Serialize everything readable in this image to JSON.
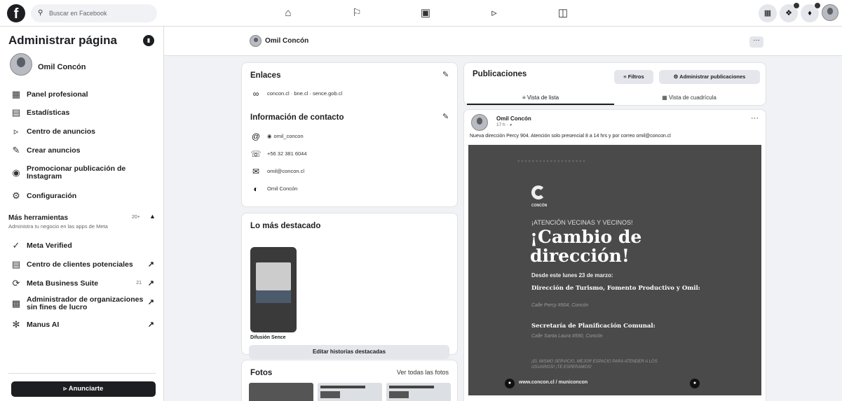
{
  "topbar": {
    "logo": "f",
    "search_placeholder": "Buscar en Facebook",
    "nav_icons": [
      "home-icon",
      "flag-icon",
      "video-icon",
      "megaphone-icon",
      "calendar-icon"
    ],
    "right_icons": [
      "grid-icon",
      "messenger-icon",
      "bell-icon",
      "profile-icon"
    ]
  },
  "sidebar": {
    "title": "Administrar página",
    "page_name": "Omil Concón",
    "items": [
      {
        "label": "Panel profesional",
        "icon": "dashboard-icon"
      },
      {
        "label": "Estadísticas",
        "icon": "chart-icon"
      },
      {
        "label": "Centro de anuncios",
        "icon": "megaphone-icon"
      },
      {
        "label": "Crear anuncios",
        "icon": "pencil-icon"
      },
      {
        "label": "Promocionar publicación de Instagram",
        "icon": "instagram-icon"
      },
      {
        "label": "Configuración",
        "icon": "gear-icon"
      }
    ],
    "more_tools": {
      "title": "Más herramientas",
      "subtitle": "Administra tu negocio en las apps de Meta",
      "count": "20+"
    },
    "tools": [
      {
        "label": "Meta Verified",
        "icon": "verified-icon",
        "count": "",
        "external": false
      },
      {
        "label": "Centro de clientes potenciales",
        "icon": "leads-icon",
        "count": "",
        "external": true
      },
      {
        "label": "Meta Business Suite",
        "icon": "business-suite-icon",
        "count": "21",
        "external": true
      },
      {
        "label": "Administrador de organizaciones sin fines de lucro",
        "icon": "nonprofit-icon",
        "count": "",
        "external": true
      },
      {
        "label": "Manus AI",
        "icon": "manus-icon",
        "count": "",
        "external": true
      }
    ],
    "promote_button": "Anunciarte"
  },
  "pagebar": {
    "name": "Omil Concón",
    "more": "···"
  },
  "links_card": {
    "title": "Enlaces",
    "links": "concon.cl · bne.cl · sence.gob.cl"
  },
  "contact_card": {
    "title": "Información de contacto",
    "rows": [
      {
        "icon": "at-icon",
        "text": "omil_concon"
      },
      {
        "icon": "phone-icon",
        "text": "+56 32 381 6044"
      },
      {
        "icon": "mail-icon",
        "text": "omil@concon.cl"
      },
      {
        "icon": "messenger-icon",
        "text": "Omil Concón"
      }
    ]
  },
  "highlights_card": {
    "title": "Lo más destacado",
    "story_label": "Difusión Sence",
    "edit_button": "Editar historias destacadas"
  },
  "photos_card": {
    "title": "Fotos",
    "see_all": "Ver todas las fotos"
  },
  "posts": {
    "title": "Publicaciones",
    "filters_button": "Filtros",
    "manage_button": "Administrar publicaciones",
    "tab_list": "Vista de lista",
    "tab_grid": "Vista de cuadrícula"
  },
  "post": {
    "author": "Omil Concón",
    "time": "17 h · ",
    "text": "Nueva dirección Percy 904. Atención solo presencial 8 a 14 hrs y por correo omil@concon.cl",
    "image": {
      "logo_text": "CONCÓN",
      "attention": "¡ATENCIÓN VECINAS Y VECINOS!",
      "headline_1": "¡Cambio de",
      "headline_2": "dirección!",
      "since": "Desde este lunes 23 de marzo:",
      "office_1": "Dirección de Turismo, Fomento Productivo y Omil:",
      "address_1": "Calle Percy #904, Concón",
      "office_2": "Secretaría de Planificación Comunal:",
      "address_2": "Calle Santa Laura #590, Concón",
      "slogan": "¡EL MISMO SERVICIO, MEJOR ESPACIO PARA ATENDER A LOS USUARIOS! ¡TE ESPERAMOS!",
      "footer": "www.concon.cl / municoncon"
    }
  }
}
